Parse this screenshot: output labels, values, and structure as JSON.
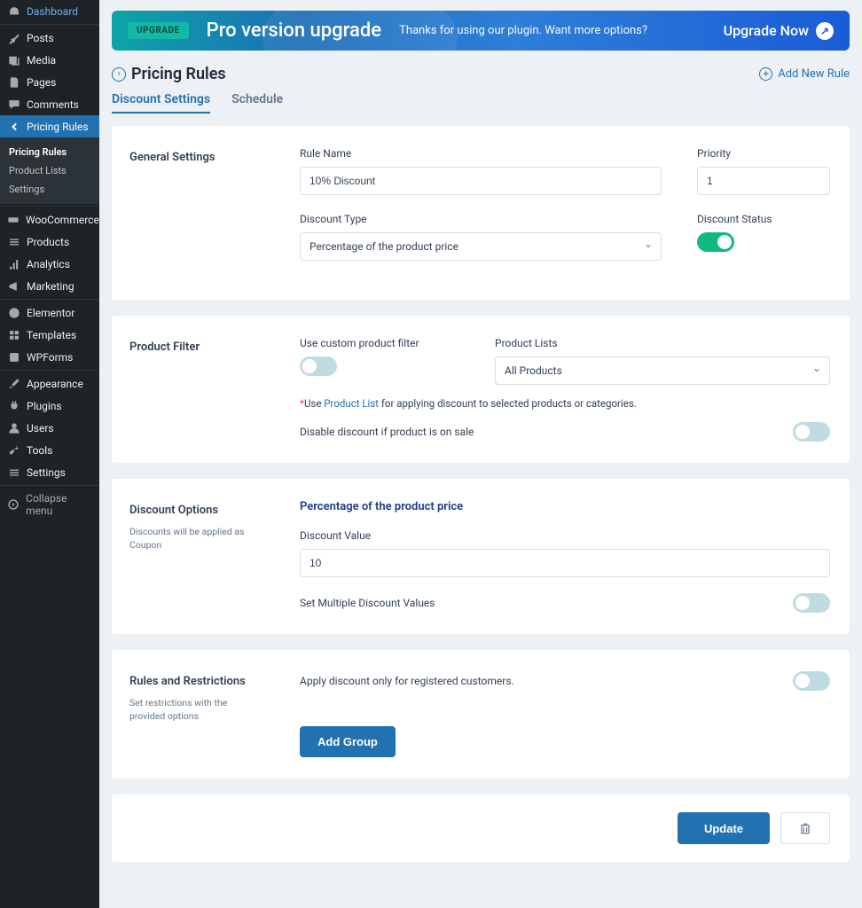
{
  "sidebar": {
    "items": [
      {
        "label": "Dashboard"
      },
      {
        "label": "Posts"
      },
      {
        "label": "Media"
      },
      {
        "label": "Pages"
      },
      {
        "label": "Comments"
      },
      {
        "label": "Pricing Rules"
      },
      {
        "label": "WooCommerce"
      },
      {
        "label": "Products"
      },
      {
        "label": "Analytics"
      },
      {
        "label": "Marketing"
      },
      {
        "label": "Elementor"
      },
      {
        "label": "Templates"
      },
      {
        "label": "WPForms"
      },
      {
        "label": "Appearance"
      },
      {
        "label": "Plugins"
      },
      {
        "label": "Users"
      },
      {
        "label": "Tools"
      },
      {
        "label": "Settings"
      },
      {
        "label": "Collapse menu"
      }
    ],
    "sub": [
      {
        "label": "Pricing Rules"
      },
      {
        "label": "Product Lists"
      },
      {
        "label": "Settings"
      }
    ]
  },
  "banner": {
    "badge": "UPGRADE",
    "title": "Pro version upgrade",
    "sub": "Thanks for using our plugin. Want more options?",
    "cta": "Upgrade Now"
  },
  "page": {
    "title": "Pricing Rules",
    "add_new": "Add New Rule"
  },
  "tabs": [
    {
      "label": "Discount Settings"
    },
    {
      "label": "Schedule"
    }
  ],
  "general": {
    "title": "General Settings",
    "rule_name_label": "Rule Name",
    "rule_name_value": "10% Discount",
    "priority_label": "Priority",
    "priority_value": "1",
    "discount_type_label": "Discount Type",
    "discount_type_value": "Percentage of the product price",
    "discount_status_label": "Discount Status"
  },
  "filter": {
    "title": "Product Filter",
    "use_custom_label": "Use custom product filter",
    "product_lists_label": "Product Lists",
    "product_lists_value": "All Products",
    "note_star": "*",
    "note_prefix": "Use ",
    "note_link": "Product List",
    "note_suffix": " for applying discount to selected products or categories.",
    "disable_on_sale_label": "Disable discount if product is on sale"
  },
  "discount_options": {
    "title": "Discount Options",
    "desc": "Discounts will be applied as Coupon",
    "subtitle": "Percentage of the product price",
    "value_label": "Discount Value",
    "value": "10",
    "multiple_label": "Set Multiple Discount Values"
  },
  "rules": {
    "title": "Rules and Restrictions",
    "desc": "Set restrictions with the provided options",
    "apply_registered": "Apply discount only for registered customers.",
    "add_group": "Add Group"
  },
  "footer": {
    "update": "Update"
  }
}
